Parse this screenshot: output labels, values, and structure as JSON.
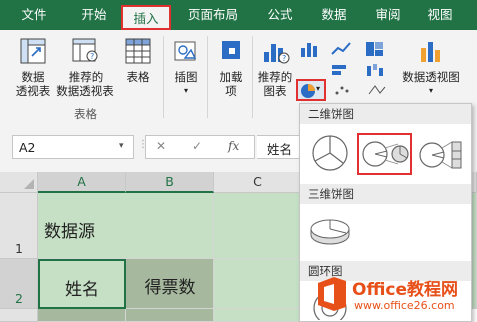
{
  "tabs": [
    "文件",
    "开始",
    "插入",
    "页面布局",
    "公式",
    "数据",
    "审阅",
    "视图"
  ],
  "ribbon": {
    "pivot_table": [
      "数据",
      "透视表"
    ],
    "recommended_pivot": [
      "推荐的",
      "数据透视表"
    ],
    "table": "表格",
    "tables_group": "表格",
    "illustrations": "插图",
    "addins": [
      "加载",
      "项"
    ],
    "recommended_charts": [
      "推荐的",
      "图表"
    ],
    "pivot_chart": "数据透视图"
  },
  "formula_bar": {
    "name_box": "A2",
    "cancel": "✕",
    "enter": "✓",
    "fx": "fx",
    "content": "姓名"
  },
  "columns": [
    "A",
    "B",
    "C"
  ],
  "rows": [
    "1",
    "2"
  ],
  "cells": {
    "A1": "数据源",
    "A2": "姓名",
    "B2": "得票数"
  },
  "gallery": {
    "section_2d_pie": "二维饼图",
    "section_3d_pie": "三维饼图",
    "section_doughnut": "圆环图"
  },
  "watermark": {
    "brand": "Office教程网",
    "url": "www.office26.com"
  },
  "colors": {
    "excel_green": "#217346",
    "highlight_red": "#e03030",
    "cell_fill": "#a6b89e",
    "grid_selected": "#d2d2d2"
  }
}
